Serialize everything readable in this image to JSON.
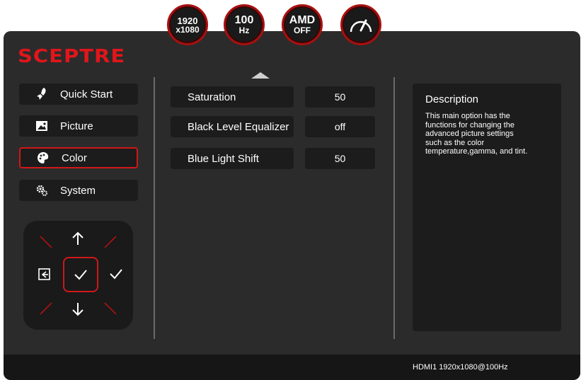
{
  "brand": "SCEPTRE",
  "badges": {
    "resolution": {
      "line1": "1920",
      "line2": "x1080"
    },
    "refresh": {
      "line1": "100",
      "line2": "Hz"
    },
    "amd": {
      "line1": "AMD",
      "line2": "OFF"
    },
    "speed_icon": "speedometer-icon"
  },
  "menu": {
    "items": [
      {
        "label": "Quick Start",
        "icon": "rocket-icon"
      },
      {
        "label": "Picture",
        "icon": "picture-icon"
      },
      {
        "label": "Color",
        "icon": "palette-icon",
        "active": true
      },
      {
        "label": "System",
        "icon": "gears-icon"
      }
    ]
  },
  "settings": {
    "rows": [
      {
        "label": "Saturation",
        "value": "50"
      },
      {
        "label": "Black Level Equalizer",
        "value": "off"
      },
      {
        "label": "Blue Light Shift",
        "value": "50"
      }
    ]
  },
  "description": {
    "title": "Description",
    "body": "This main option has the functions for changing the advanced picture settings such as the color temperature,gamma, and tint."
  },
  "status_bar": {
    "text": "HDMI1 1920x1080@100Hz"
  },
  "colors": {
    "accent": "#d01818",
    "panel": "#2b2b2b",
    "item": "#1c1c1c"
  }
}
